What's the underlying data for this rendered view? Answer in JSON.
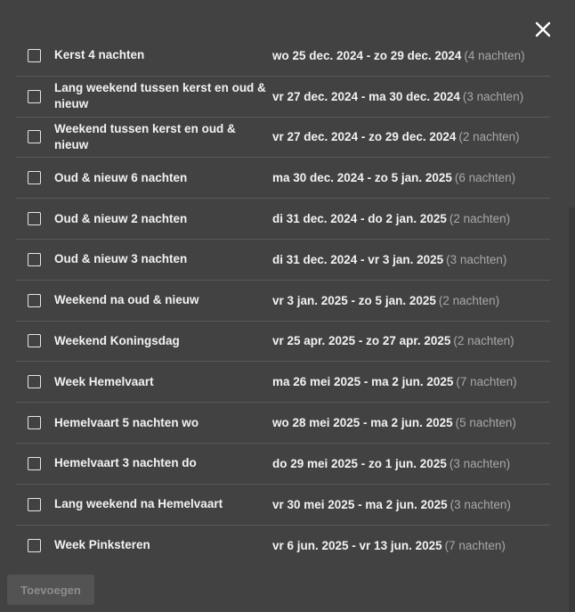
{
  "close": {
    "icon": "close-icon"
  },
  "items": [
    {
      "label": "Kerst 4 nachten",
      "dates": "wo 25 dec. 2024 - zo 29 dec. 2024",
      "nights": "(4 nachten)"
    },
    {
      "label": "Lang weekend tussen kerst en oud & nieuw",
      "dates": "vr 27 dec. 2024 - ma 30 dec. 2024",
      "nights": "(3 nachten)"
    },
    {
      "label": "Weekend tussen kerst en oud & nieuw",
      "dates": "vr 27 dec. 2024 - zo 29 dec. 2024",
      "nights": "(2 nachten)"
    },
    {
      "label": "Oud & nieuw 6 nachten",
      "dates": "ma 30 dec. 2024 - zo 5 jan. 2025",
      "nights": "(6 nachten)"
    },
    {
      "label": "Oud & nieuw 2 nachten",
      "dates": "di 31 dec. 2024 - do 2 jan. 2025",
      "nights": "(2 nachten)"
    },
    {
      "label": "Oud & nieuw 3 nachten",
      "dates": "di 31 dec. 2024 - vr 3 jan. 2025",
      "nights": "(3 nachten)"
    },
    {
      "label": "Weekend na oud & nieuw",
      "dates": "vr 3 jan. 2025 - zo 5 jan. 2025",
      "nights": "(2 nachten)"
    },
    {
      "label": "Weekend Koningsdag",
      "dates": "vr 25 apr. 2025 - zo 27 apr. 2025",
      "nights": "(2 nachten)"
    },
    {
      "label": "Week Hemelvaart",
      "dates": "ma 26 mei 2025 - ma 2 jun. 2025",
      "nights": "(7 nachten)"
    },
    {
      "label": "Hemelvaart 5 nachten wo",
      "dates": "wo 28 mei 2025 - ma 2 jun. 2025",
      "nights": "(5 nachten)"
    },
    {
      "label": "Hemelvaart 3 nachten do",
      "dates": "do 29 mei 2025 - zo 1 jun. 2025",
      "nights": "(3 nachten)"
    },
    {
      "label": "Lang weekend na Hemelvaart",
      "dates": "vr 30 mei 2025 - ma 2 jun. 2025",
      "nights": "(3 nachten)"
    },
    {
      "label": "Week Pinksteren",
      "dates": "vr 6 jun. 2025 - vr 13 jun. 2025",
      "nights": "(7 nachten)"
    }
  ],
  "add_button": {
    "label": "Toevoegen",
    "enabled": false
  },
  "colors": {
    "background": "#424242",
    "divider": "#595959",
    "muted": "#a8a8a8"
  }
}
